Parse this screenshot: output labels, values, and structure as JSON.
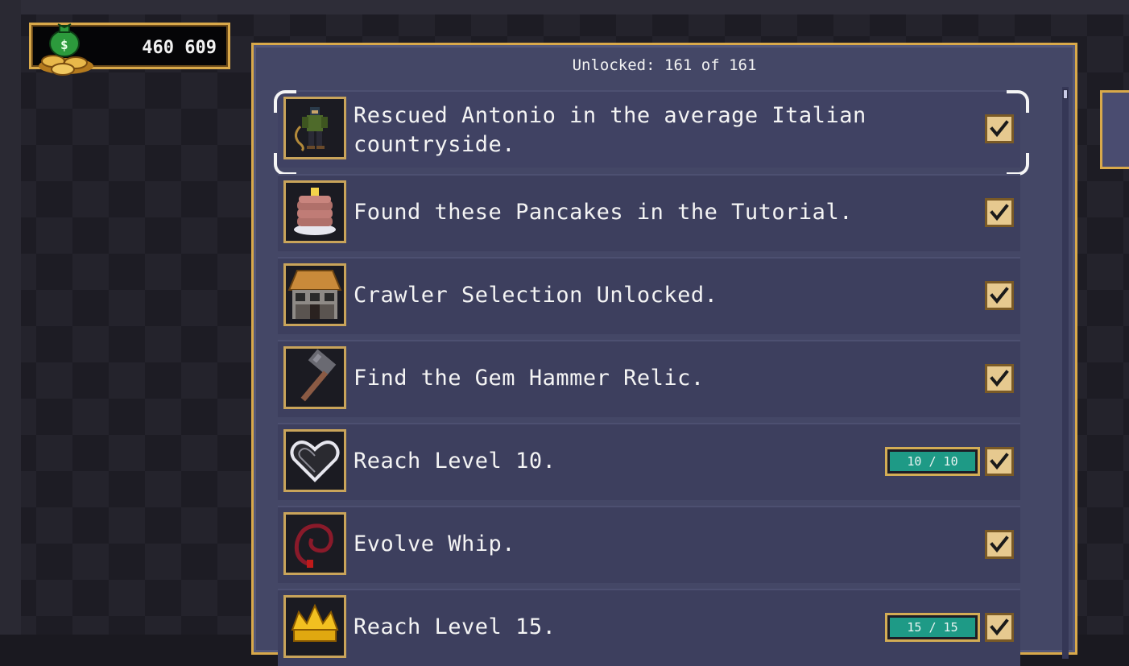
{
  "coins": {
    "amount": "460 609",
    "icon": "coin-bag-icon"
  },
  "panel": {
    "unlocked_label": "Unlocked: 161 of 161"
  },
  "achievements": [
    {
      "text": "Rescued Antonio in the average Italian countryside.",
      "icon": "antonio-icon",
      "checked": true,
      "selected": true
    },
    {
      "text": "Found these Pancakes in the Tutorial.",
      "icon": "pancakes-icon",
      "checked": true
    },
    {
      "text": "Crawler Selection Unlocked.",
      "icon": "shop-building-icon",
      "checked": true
    },
    {
      "text": "Find the Gem Hammer Relic.",
      "icon": "hammer-icon",
      "checked": true
    },
    {
      "text": "Reach Level 10.",
      "icon": "heart-icon",
      "checked": true,
      "progress": {
        "label": "10 / 10",
        "fraction": 1.0
      }
    },
    {
      "text": "Evolve Whip.",
      "icon": "whip-icon",
      "checked": true
    },
    {
      "text": "Reach Level 15.",
      "icon": "crown-icon",
      "checked": true,
      "progress": {
        "label": "15 / 15",
        "fraction": 1.0
      }
    }
  ],
  "colors": {
    "gold": "#d9a94a",
    "panel": "#444766",
    "progress": "#1e9a86"
  }
}
